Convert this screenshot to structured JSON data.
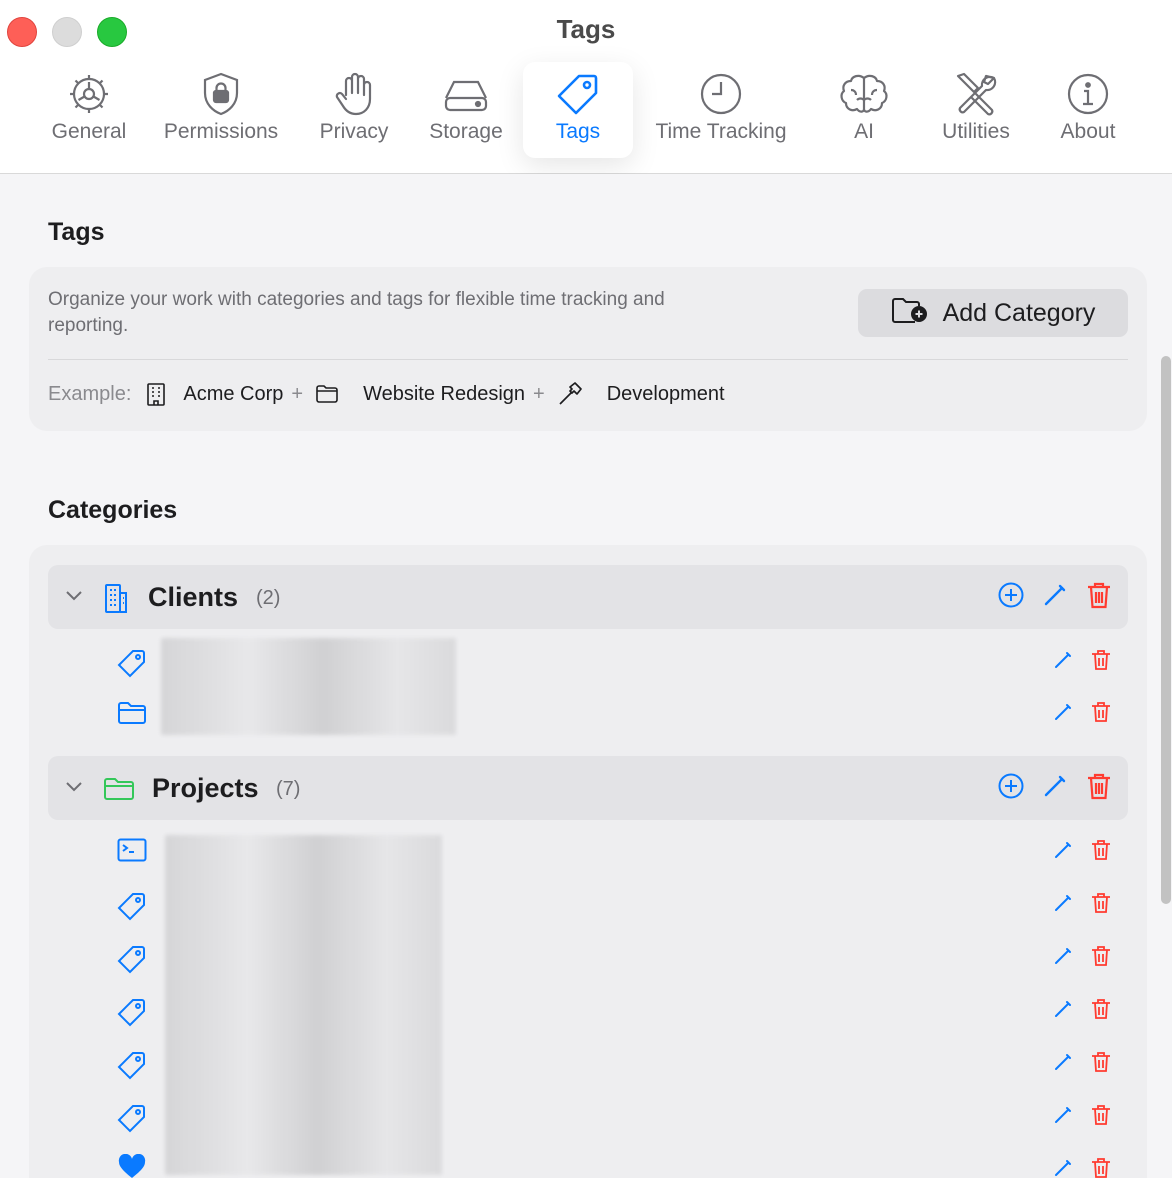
{
  "window": {
    "title": "Tags"
  },
  "toolbar": {
    "tabs": [
      {
        "label": "General",
        "icon": "gear-icon"
      },
      {
        "label": "Permissions",
        "icon": "lock-shield-icon"
      },
      {
        "label": "Privacy",
        "icon": "hand-icon"
      },
      {
        "label": "Storage",
        "icon": "drive-icon"
      },
      {
        "label": "Tags",
        "icon": "tag-icon",
        "active": true
      },
      {
        "label": "Time Tracking",
        "icon": "clock-icon"
      },
      {
        "label": "AI",
        "icon": "brain-icon"
      },
      {
        "label": "Utilities",
        "icon": "tools-icon"
      },
      {
        "label": "About",
        "icon": "info-icon"
      }
    ]
  },
  "tags_section": {
    "heading": "Tags",
    "description": "Organize your work with categories and tags for flexible time tracking and reporting.",
    "add_category_label": "Add Category",
    "example": {
      "label": "Example:",
      "client": "Acme Corp",
      "plus": "+",
      "project": "Website Redesign",
      "task": "Development"
    }
  },
  "categories_section": {
    "heading": "Categories",
    "categories": [
      {
        "name": "Clients",
        "count": "(2)",
        "icon": "building-icon",
        "items": [
          {
            "icon": "tag-icon"
          },
          {
            "icon": "folder-icon"
          }
        ]
      },
      {
        "name": "Projects",
        "count": "(7)",
        "icon": "folder-icon",
        "items": [
          {
            "icon": "terminal-icon"
          },
          {
            "icon": "tag-icon"
          },
          {
            "icon": "tag-icon"
          },
          {
            "icon": "tag-icon"
          },
          {
            "icon": "tag-icon"
          },
          {
            "icon": "tag-icon"
          },
          {
            "icon": "heart-icon"
          }
        ]
      }
    ]
  },
  "colors": {
    "accent": "#0a7aff",
    "delete": "#ff3b30",
    "projects_icon": "#34c759"
  }
}
